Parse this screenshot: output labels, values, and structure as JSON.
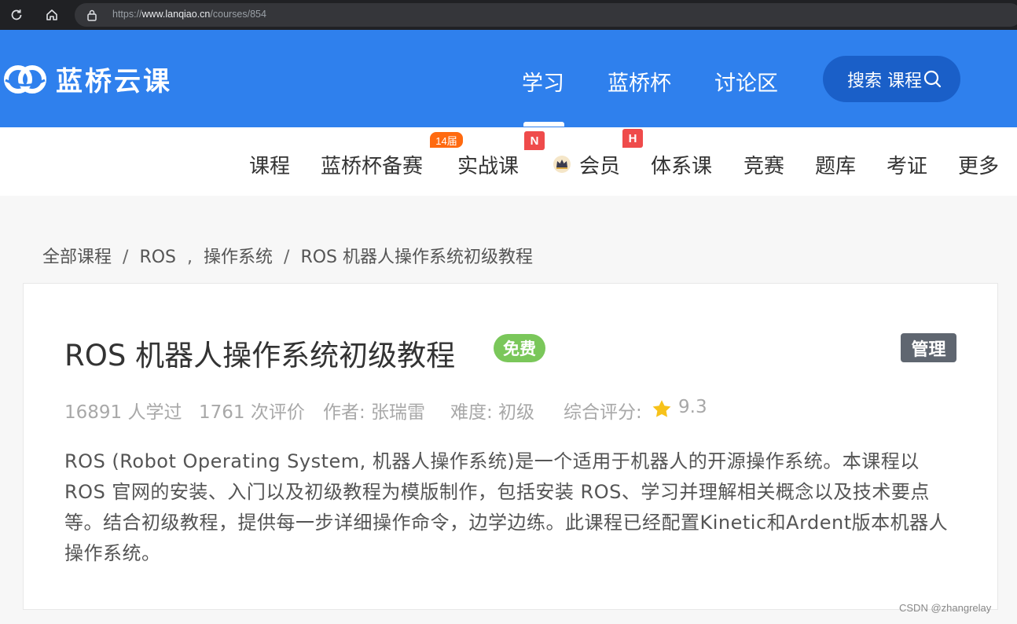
{
  "browser": {
    "url_prefix": "https://",
    "url_domain": "www.lanqiao.cn",
    "url_path": "/courses/854"
  },
  "header": {
    "logo_text": "蓝桥云课",
    "nav": [
      "学习",
      "蓝桥杯",
      "讨论区"
    ],
    "search_label": "搜索 课程"
  },
  "subnav": {
    "items": [
      "课程",
      "蓝桥杯备赛",
      "实战课",
      "会员",
      "体系课",
      "竞赛",
      "题库",
      "考证",
      "更多"
    ],
    "badge_year": "14届",
    "badge_new": "N",
    "badge_hot": "H"
  },
  "breadcrumb": {
    "items": [
      "全部课程",
      "ROS",
      "操作系统",
      "ROS 机器人操作系统初级教程"
    ],
    "sep1": "/",
    "sep2": ",",
    "sep3": "/"
  },
  "course": {
    "title": "ROS 机器人操作系统初级教程",
    "price_badge": "免费",
    "manage_label": "管理",
    "learners": "16891 人学过",
    "reviews": "1761 次评价",
    "author": "作者: 张瑞雷",
    "difficulty": "难度: 初级",
    "rating_label": "综合评分:",
    "rating_value": "9.3",
    "description": "ROS (Robot Operating System, 机器人操作系统)是一个适用于机器人的开源操作系统。本课程以 ROS 官网的安装、入门以及初级教程为模版制作，包括安装 ROS、学习并理解相关概念以及技术要点等。结合初级教程，提供每一步详细操作命令，边学边练。此课程已经配置Kinetic和Ardent版本机器人操作系统。"
  },
  "watermark": "CSDN @zhangrelay",
  "colors": {
    "header_blue": "#2f80ed",
    "search_blue": "#1a5fc8",
    "free_green": "#7ac75a",
    "badge_orange": "#ff6a10",
    "badge_red": "#ef4b4b"
  }
}
